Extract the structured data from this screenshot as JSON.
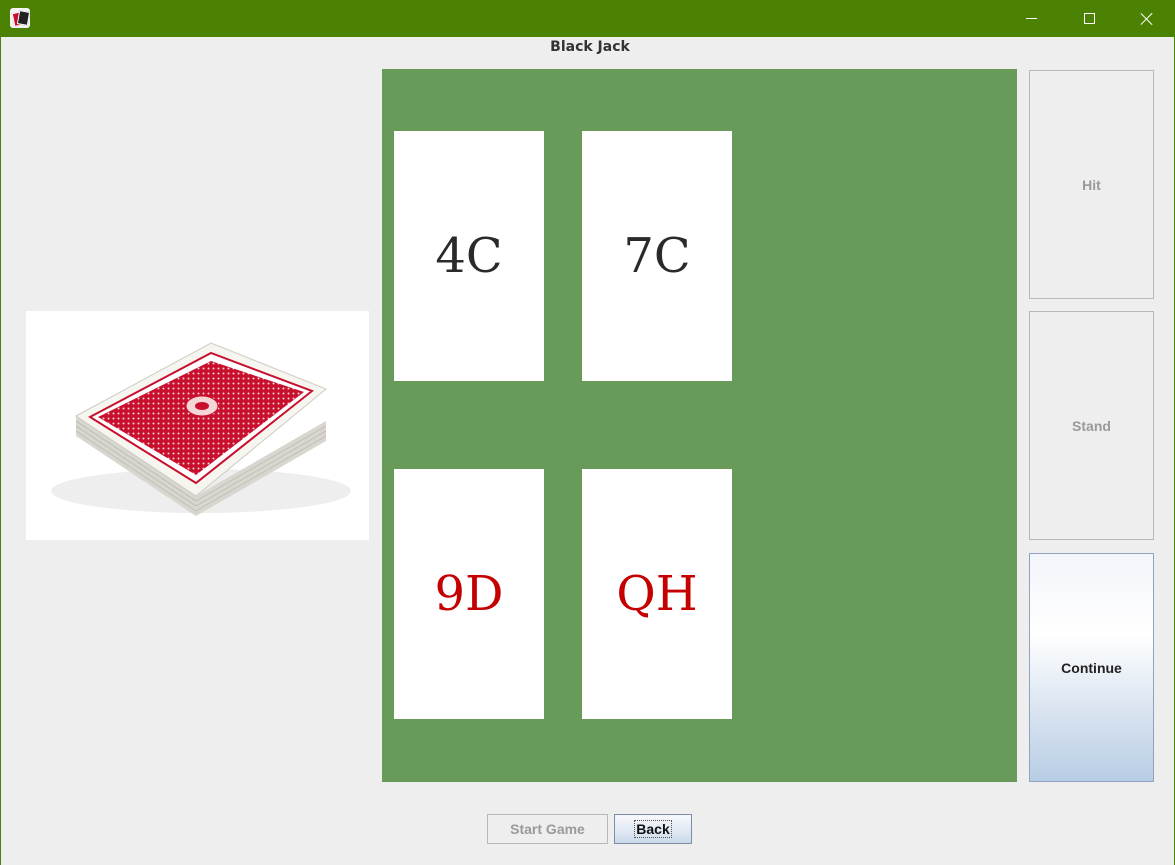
{
  "window": {
    "icon": "playing-cards-app-icon",
    "controls": [
      "minimize-icon",
      "maximize-icon",
      "close-icon"
    ],
    "titlebar_color": "#4c8203"
  },
  "game": {
    "title": "Black Jack",
    "table_color": "#689b5a"
  },
  "deck": {
    "image": "card-deck-image",
    "back_color": "#c8102e"
  },
  "cards": [
    {
      "label": "4C",
      "color": "#2a2a2a"
    },
    {
      "label": "7C",
      "color": "#2a2a2a"
    },
    {
      "label": "9D",
      "color": "#c40000"
    },
    {
      "label": "QH",
      "color": "#c40000"
    }
  ],
  "actions": {
    "hit": "Hit",
    "stand": "Stand",
    "continue": "Continue",
    "start_game": "Start Game",
    "back": "Back"
  }
}
